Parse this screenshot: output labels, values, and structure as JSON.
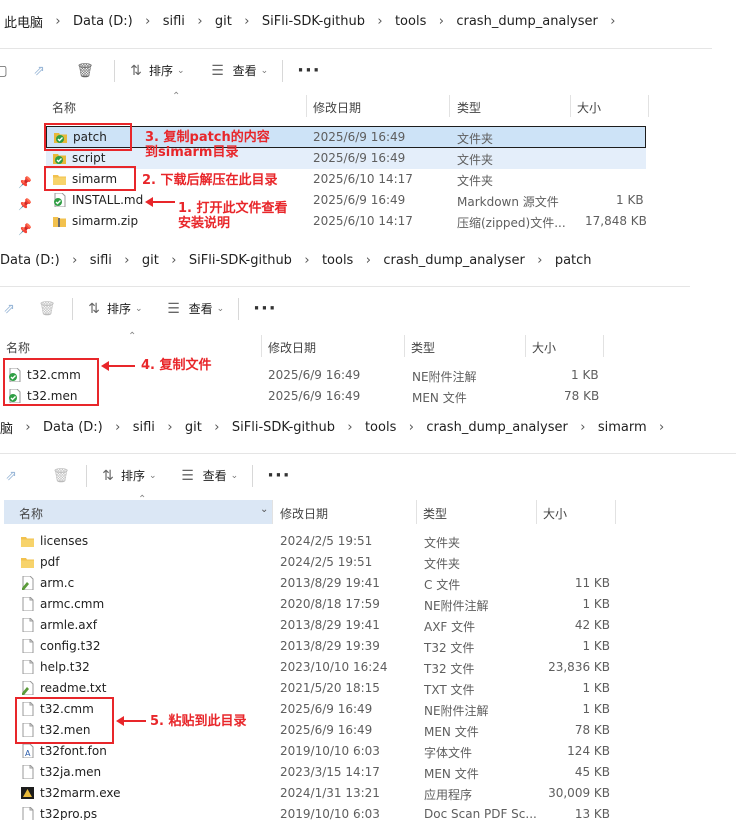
{
  "win1": {
    "breadcrumb": [
      "此电脑",
      "Data (D:)",
      "sifli",
      "git",
      "SiFli-SDK-github",
      "tools",
      "crash_dump_analyser"
    ],
    "toolbar": {
      "sort": "排序",
      "view": "查看",
      "more": "···"
    },
    "columns": {
      "name": "名称",
      "date": "修改日期",
      "type": "类型",
      "size": "大小"
    },
    "rows": [
      {
        "name": "patch",
        "date": "2025/6/9 16:49",
        "type": "文件夹",
        "size": "",
        "icon": "folder-sync-icon"
      },
      {
        "name": "script",
        "date": "2025/6/9 16:49",
        "type": "文件夹",
        "size": "",
        "icon": "folder-sync-icon"
      },
      {
        "name": "simarm",
        "date": "2025/6/10 14:17",
        "type": "文件夹",
        "size": "",
        "icon": "folder-icon"
      },
      {
        "name": "INSTALL.md",
        "date": "2025/6/9 16:49",
        "type": "Markdown 源文件",
        "size": "1 KB",
        "icon": "file-sync-icon"
      },
      {
        "name": "simarm.zip",
        "date": "2025/6/10 14:17",
        "type": "压缩(zipped)文件...",
        "size": "17,848 KB",
        "icon": "zip-icon"
      }
    ],
    "notes": {
      "n3a": "3. 复制patch的内容",
      "n3b": "到simarm目录",
      "n2": "2. 下载后解压在此目录",
      "n1a": "1. 打开此文件查看",
      "n1b": "安装说明"
    }
  },
  "win2": {
    "breadcrumb": [
      "Data (D:)",
      "sifli",
      "git",
      "SiFli-SDK-github",
      "tools",
      "crash_dump_analyser",
      "patch"
    ],
    "toolbar": {
      "sort": "排序",
      "view": "查看",
      "more": "···"
    },
    "columns": {
      "name": "名称",
      "date": "修改日期",
      "type": "类型",
      "size": "大小"
    },
    "rows": [
      {
        "name": "t32.cmm",
        "date": "2025/6/9 16:49",
        "type": "NE附件注解",
        "size": "1 KB"
      },
      {
        "name": "t32.men",
        "date": "2025/6/9 16:49",
        "type": "MEN 文件",
        "size": "78 KB"
      }
    ],
    "notes": {
      "n4": "4. 复制文件"
    }
  },
  "win3": {
    "breadcrumb": [
      "脑",
      "Data (D:)",
      "sifli",
      "git",
      "SiFli-SDK-github",
      "tools",
      "crash_dump_analyser",
      "simarm"
    ],
    "toolbar": {
      "sort": "排序",
      "view": "查看",
      "more": "···"
    },
    "columns": {
      "name": "名称",
      "date": "修改日期",
      "type": "类型",
      "size": "大小"
    },
    "rows": [
      {
        "name": "licenses",
        "date": "2024/2/5 19:51",
        "type": "文件夹",
        "size": "",
        "icon": "folder-icon"
      },
      {
        "name": "pdf",
        "date": "2024/2/5 19:51",
        "type": "文件夹",
        "size": "",
        "icon": "folder-icon"
      },
      {
        "name": "arm.c",
        "date": "2013/8/29 19:41",
        "type": "C 文件",
        "size": "11 KB",
        "icon": "c-file-icon"
      },
      {
        "name": "armc.cmm",
        "date": "2020/8/18 17:59",
        "type": "NE附件注解",
        "size": "1 KB",
        "icon": "file-icon"
      },
      {
        "name": "armle.axf",
        "date": "2013/8/29 19:41",
        "type": "AXF 文件",
        "size": "42 KB",
        "icon": "file-icon"
      },
      {
        "name": "config.t32",
        "date": "2013/8/29 19:39",
        "type": "T32 文件",
        "size": "1 KB",
        "icon": "file-icon"
      },
      {
        "name": "help.t32",
        "date": "2023/10/10 16:24",
        "type": "T32 文件",
        "size": "23,836 KB",
        "icon": "file-icon"
      },
      {
        "name": "readme.txt",
        "date": "2021/5/20 18:15",
        "type": "TXT 文件",
        "size": "1 KB",
        "icon": "txt-file-icon"
      },
      {
        "name": "t32.cmm",
        "date": "2025/6/9 16:49",
        "type": "NE附件注解",
        "size": "1 KB",
        "icon": "file-icon"
      },
      {
        "name": "t32.men",
        "date": "2025/6/9 16:49",
        "type": "MEN 文件",
        "size": "78 KB",
        "icon": "file-icon"
      },
      {
        "name": "t32font.fon",
        "date": "2019/10/10 6:03",
        "type": "字体文件",
        "size": "124 KB",
        "icon": "font-file-icon"
      },
      {
        "name": "t32ja.men",
        "date": "2023/3/15 14:17",
        "type": "MEN 文件",
        "size": "45 KB",
        "icon": "file-icon"
      },
      {
        "name": "t32marm.exe",
        "date": "2024/1/31 13:21",
        "type": "应用程序",
        "size": "30,009 KB",
        "icon": "exe-icon"
      },
      {
        "name": "t32pro.ps",
        "date": "2019/10/10 6:03",
        "type": "Doc Scan PDF Sc...",
        "size": "13 KB",
        "icon": "file-icon"
      }
    ],
    "notes": {
      "n5": "5. 粘贴到此目录"
    }
  }
}
